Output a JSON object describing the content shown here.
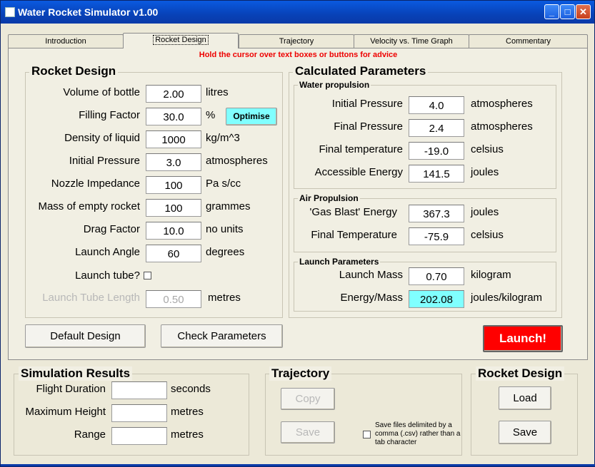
{
  "window": {
    "title": "Water Rocket Simulator v1.00"
  },
  "tabs": [
    {
      "label": "Introduction"
    },
    {
      "label": "Rocket Design"
    },
    {
      "label": "Trajectory"
    },
    {
      "label": "Velocity vs. Time Graph"
    },
    {
      "label": "Commentary"
    }
  ],
  "hint": "Hold the cursor over text boxes or buttons for advice",
  "rocket_design": {
    "title": "Rocket Design",
    "fields": [
      {
        "label": "Volume of bottle",
        "value": "2.00",
        "unit": "litres"
      },
      {
        "label": "Filling Factor",
        "value": "30.0",
        "unit": "%"
      },
      {
        "label": "Density of liquid",
        "value": "1000",
        "unit": "kg/m^3"
      },
      {
        "label": "Initial Pressure",
        "value": "3.0",
        "unit": "atmospheres"
      },
      {
        "label": "Nozzle Impedance",
        "value": "100",
        "unit": "Pa s/cc"
      },
      {
        "label": "Mass of empty rocket",
        "value": "100",
        "unit": "grammes"
      },
      {
        "label": "Drag Factor",
        "value": "10.0",
        "unit": "no units"
      },
      {
        "label": "Launch Angle",
        "value": "60",
        "unit": "degrees"
      }
    ],
    "optimise_label": "Optimise",
    "launch_tube_label": "Launch tube?",
    "launch_tube_checked": false,
    "tube_length": {
      "label": "Launch Tube Length",
      "value": "0.50",
      "unit": "metres"
    }
  },
  "calculated": {
    "title": "Calculated Parameters",
    "water": {
      "title": "Water propulsion",
      "fields": [
        {
          "label": "Initial Pressure",
          "value": "4.0",
          "unit": "atmospheres"
        },
        {
          "label": "Final Pressure",
          "value": "2.4",
          "unit": "atmospheres"
        },
        {
          "label": "Final temperature",
          "value": "-19.0",
          "unit": "celsius"
        },
        {
          "label": "Accessible Energy",
          "value": "141.5",
          "unit": "joules"
        }
      ]
    },
    "air": {
      "title": "Air Propulsion",
      "fields": [
        {
          "label": "'Gas Blast' Energy",
          "value": "367.3",
          "unit": "joules"
        },
        {
          "label": "Final Temperature",
          "value": "-75.9",
          "unit": "celsius"
        }
      ]
    },
    "launch": {
      "title": "Launch Parameters",
      "fields": [
        {
          "label": "Launch Mass",
          "value": "0.70",
          "unit": "kilogram"
        },
        {
          "label": "Energy/Mass",
          "value": "202.08",
          "unit": "joules/kilogram"
        }
      ]
    }
  },
  "buttons": {
    "default_design": "Default Design",
    "check_parameters": "Check Parameters",
    "launch": "Launch!"
  },
  "simulation": {
    "title": "Simulation Results",
    "fields": [
      {
        "label": "Flight Duration",
        "value": "",
        "unit": "seconds"
      },
      {
        "label": "Maximum Height",
        "value": "",
        "unit": "metres"
      },
      {
        "label": "Range",
        "value": "",
        "unit": "metres"
      }
    ]
  },
  "trajectory": {
    "title": "Trajectory",
    "copy_label": "Copy",
    "save_label": "Save",
    "csv_note": "Save files delimited by a comma (.csv) rather than a tab character"
  },
  "design_files": {
    "title": "Rocket Design",
    "load_label": "Load",
    "save_label": "Save"
  },
  "colors": {
    "accent_red": "#ff0000",
    "hint_red": "#e00000",
    "highlight_cyan": "#80ffff",
    "titlebar_blue": "#0842b8"
  }
}
